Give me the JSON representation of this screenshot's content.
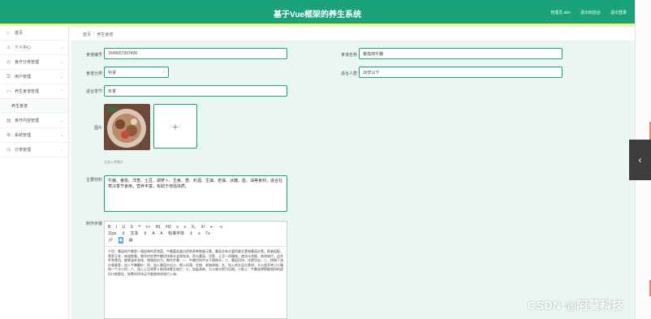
{
  "app": {
    "title": "基于Vue框架的养生系统",
    "top_links": [
      "管理员 abo",
      "退出到前台",
      "退出登录"
    ],
    "brand_color": "#1aa37a"
  },
  "sidebar": {
    "items": [
      {
        "label": "首页",
        "icon": "home-icon"
      },
      {
        "label": "个人中心",
        "icon": "user-icon"
      },
      {
        "label": "食疗分类管理",
        "icon": "category-icon"
      },
      {
        "label": "用户管理",
        "icon": "users-icon"
      },
      {
        "label": "养生食谱管理",
        "icon": "recipe-icon"
      },
      {
        "label": "养生食谱",
        "icon": "",
        "sub": true
      },
      {
        "label": "食疗内容管理",
        "icon": "content-icon"
      },
      {
        "label": "系统管理",
        "icon": "settings-icon"
      },
      {
        "label": "订单管理",
        "icon": "order-icon"
      }
    ]
  },
  "breadcrumb": {
    "home": "首页",
    "current": "养生食谱"
  },
  "form": {
    "code": {
      "label": "食谱编号",
      "value": "1649657997406"
    },
    "name": {
      "label": "食谱名称",
      "value": "番茄炖牛腩"
    },
    "category": {
      "label": "食谱分类",
      "value": "补肾"
    },
    "population": {
      "label": "适合人群",
      "value": "30岁以下"
    },
    "season": {
      "label": "适合季节",
      "value": "冬季"
    },
    "image": {
      "label": "图片",
      "hint": "点击上传图片"
    },
    "material": {
      "label": "主要材料",
      "value": "牛腩、番茄、洋葱、土豆、胡萝卜、生姜、葱、料酒、生抽、老抽、冰糖、盐、油等食材，适合在寒冷季节食用，营养丰富，有助于增强体质。"
    },
    "content": {
      "label": "制作步骤"
    }
  },
  "editor": {
    "toolbar_row1": [
      "B",
      "I",
      "U",
      "S",
      "❝",
      "<>",
      "H1",
      "H2",
      "≡",
      "≡",
      "X₂",
      "X²",
      "⇤",
      "⇥"
    ],
    "toolbar_row2": [
      "11px",
      "⇕",
      "文本",
      "⇕",
      "A",
      "A",
      "标准字体",
      "⇕",
      "≡",
      "Tx"
    ],
    "toolbar_row3": [
      "🔗",
      "▣",
      "▤"
    ],
    "body": "介绍：番茄炖牛腩是一道经典的家常菜，牛腩富含蛋白质和多种微量元素，番茄含有丰富的维生素和番茄红素。两者搭配，营养互补，味道鲜美。制作时先将牛腩切块焯水去除血沫，再与番茄、洋葱、土豆一同慢炖，使汤汁浓郁，肉质软烂。适合冬季食用，能够温补身体、增强抵抗力。制作步骤：一、牛腩切块冷水下锅焯水；二、番茄切块，洋葱切丝；三、热锅下油炒香姜葱，加入牛腩翻炒；四、加入番茄炒出汁，倒入料酒、生抽、老抽调味；五、加入热水没过食材，大火烧开转小火慢炖一个半小时；六、加入土豆胡萝卜继续炖煮至软烂；七、加盐调味，大火收汁即可出锅。小贴士：牛腩选择肥瘦相间的部位口感更佳，炖煮时间充足才能使肉质软烂入味。"
  },
  "watermark": "CSDN @阿莫科技"
}
